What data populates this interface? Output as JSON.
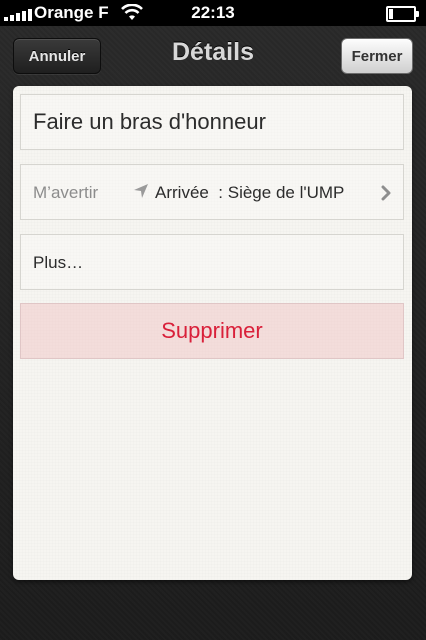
{
  "status_bar": {
    "carrier": "Orange F",
    "time": "22:13",
    "signal_bars": 5,
    "wifi_icon": "wifi-icon",
    "battery_level": 0.15
  },
  "nav": {
    "title": "Détails",
    "cancel_label": "Annuler",
    "close_label": "Fermer"
  },
  "reminder": {
    "title": "Faire un bras d'honneur",
    "alarm_label": "M’avertir",
    "alarm_icon": "location-arrow-icon",
    "alarm_value": "Arrivée  : Siège de l'UMP",
    "more_label": "Plus…",
    "delete_label": "Supprimer"
  },
  "colors": {
    "delete_text": "#d9203a",
    "paper": "#f6f5f1"
  }
}
